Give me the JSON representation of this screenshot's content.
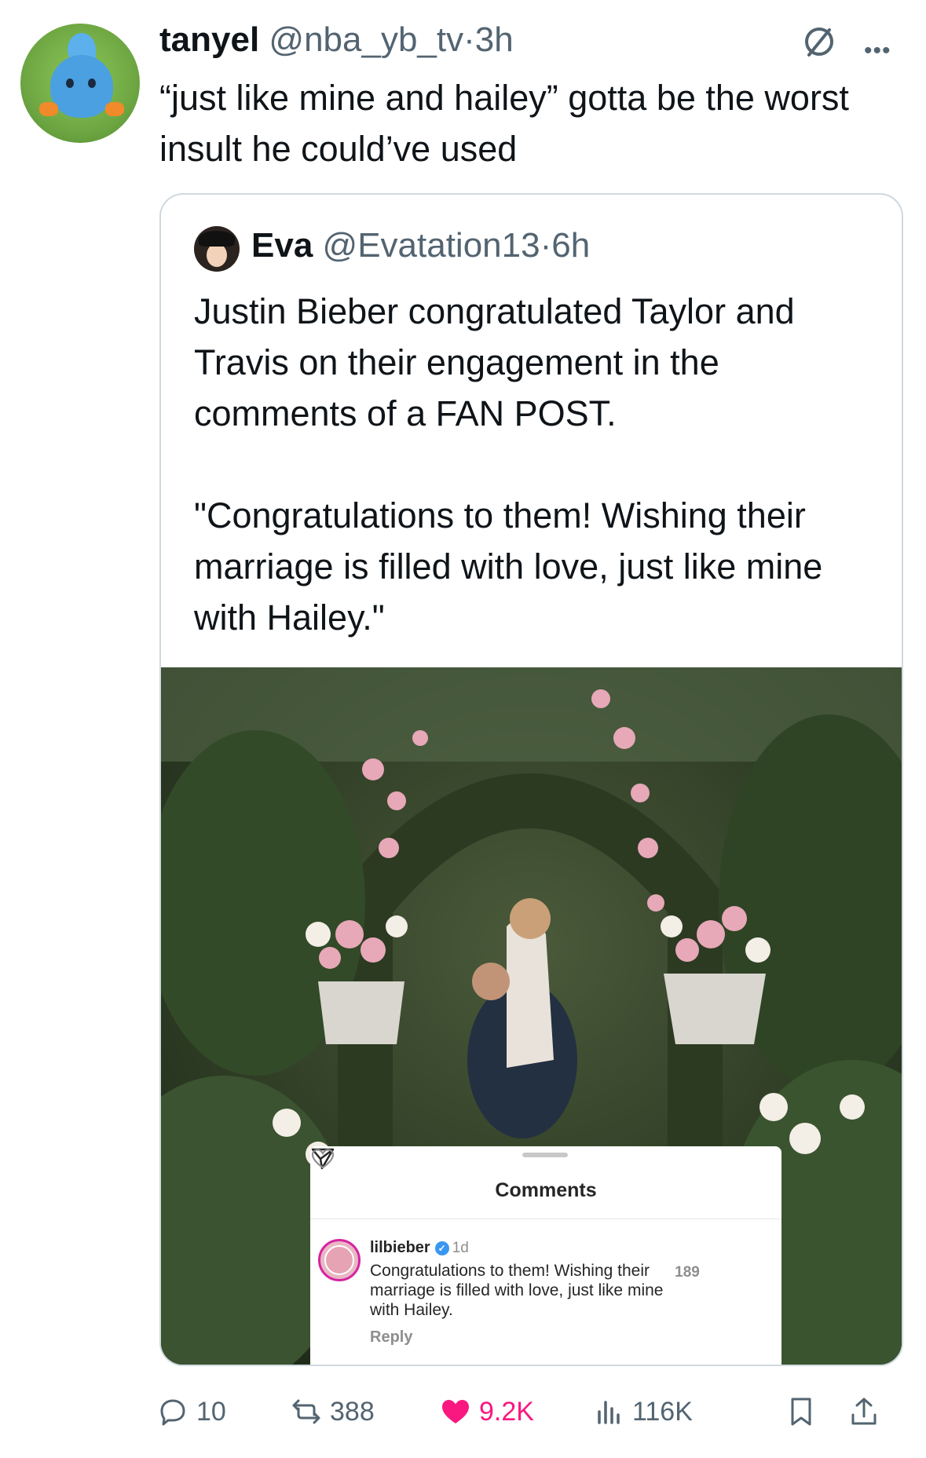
{
  "tweet": {
    "author_name": "tanyel",
    "author_handle": "@nba_yb_tv",
    "separator": "·",
    "time": "3h",
    "text": "“just like mine and hailey” gotta be the worst insult he could’ve used"
  },
  "quoted_tweet": {
    "author_name": "Eva",
    "author_handle": "@Evatation13",
    "separator": "·",
    "time": "6h",
    "paragraph1": "Justin Bieber congratulated Taylor and Travis on their engagement in the comments of a FAN POST.",
    "paragraph2": "\"Congratulations to them! Wishing their marriage is filled with love, just like mine with Hailey.\"",
    "screenshot": {
      "panel_title": "Comments",
      "commenter": "lilbieber",
      "comment_time": "1d",
      "comment_text": "Congratulations to them! Wishing their marriage is filled with love, just like mine with Hailey.",
      "reply_label": "Reply",
      "likes": "189"
    }
  },
  "actions": {
    "replies": "10",
    "reposts": "388",
    "likes": "9.2K",
    "views": "116K"
  },
  "colors": {
    "like_pink": "#f91880",
    "muted": "#536471",
    "border": "#cfd9de",
    "verified_blue": "#3897f0"
  },
  "icons": [
    "grok-icon",
    "more-icon",
    "reply-icon",
    "repost-icon",
    "heart-icon",
    "views-icon",
    "bookmark-icon",
    "share-icon",
    "send-icon",
    "ig-heart-icon"
  ]
}
